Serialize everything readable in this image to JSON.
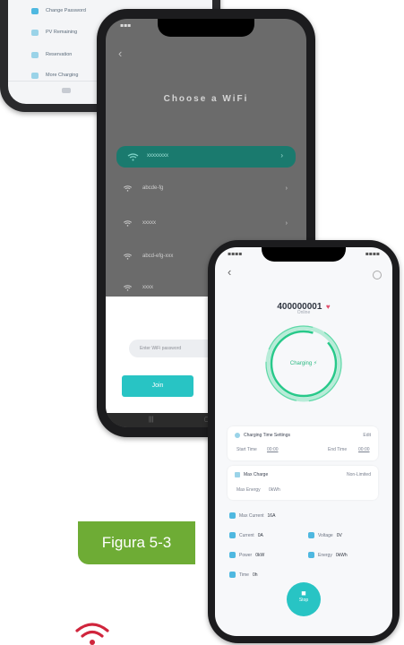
{
  "colors": {
    "teal": "#1aa596",
    "accent_cyan": "#28c4c4",
    "green_label": "#6eac35",
    "wifi_red": "#d0253c"
  },
  "top_phone": {
    "menu": [
      {
        "label": "Change Password",
        "icon": "lock-icon"
      },
      {
        "label": "PV Remaining",
        "icon": "panel-icon"
      },
      {
        "label": "Reservation",
        "icon": "calendar-icon"
      },
      {
        "label": "More Charging",
        "icon": "bolt-icon"
      }
    ]
  },
  "wifi_phone": {
    "title": "Choose a WiFi",
    "networks": [
      {
        "name": "xxxxxxxx",
        "selected": true
      },
      {
        "name": "abcde-fg"
      },
      {
        "name": "xxxxx"
      },
      {
        "name": "abcd-efg-xxx"
      },
      {
        "name": "xxxx"
      }
    ],
    "password_placeholder": "Enter WiFi password",
    "confirm_label": "Join"
  },
  "charger_phone": {
    "serial": "400000001",
    "sub": "Online",
    "ring_label": "Charging",
    "schedule_title": "Charging Time Settings",
    "schedule_action": "Edit",
    "start_label": "Start Time",
    "start_value": "00:00",
    "end_label": "End Time",
    "end_value": "00:00",
    "max_charge_label": "Max Charge",
    "max_charge_value": "Non-Limited",
    "max_energy_label": "Max Energy",
    "max_energy_value": "0kWh",
    "max_current_label": "Max Current",
    "max_current_value": "16A",
    "stats": [
      {
        "label": "Current",
        "value": "0A"
      },
      {
        "label": "Voltage",
        "value": "0V"
      },
      {
        "label": "Power",
        "value": "0kW"
      },
      {
        "label": "Energy",
        "value": "0kWh"
      },
      {
        "label": "Time",
        "value": "0h"
      }
    ],
    "stop_label": "Stop"
  },
  "figure_label": "Figura 5-3"
}
